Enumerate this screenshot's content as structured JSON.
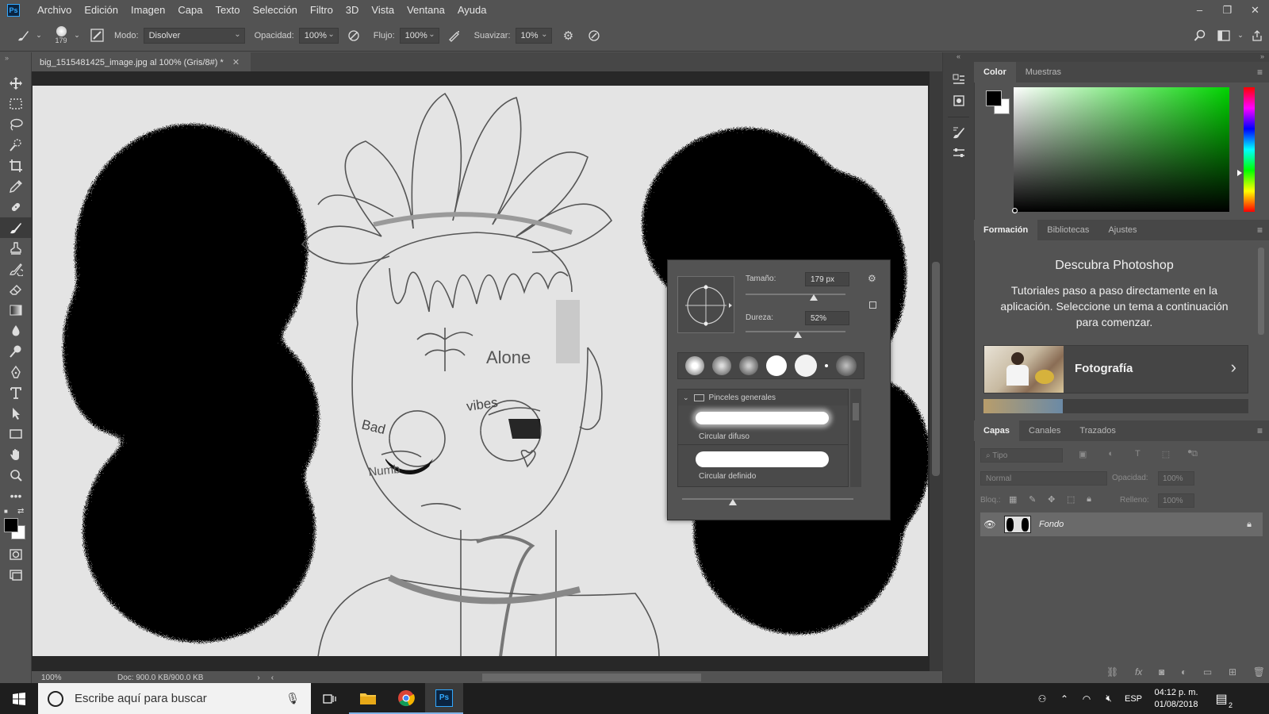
{
  "menubar": {
    "logo": "Ps",
    "items": [
      "Archivo",
      "Edición",
      "Imagen",
      "Capa",
      "Texto",
      "Selección",
      "Filtro",
      "3D",
      "Vista",
      "Ventana",
      "Ayuda"
    ],
    "window_controls": [
      "–",
      "❐",
      "✕"
    ]
  },
  "options": {
    "brush_size": "179",
    "mode_label": "Modo:",
    "mode_value": "Disolver",
    "opacity_label": "Opacidad:",
    "opacity_value": "100%",
    "flow_label": "Flujo:",
    "flow_value": "100%",
    "smoothing_label": "Suavizar:",
    "smoothing_value": "10%"
  },
  "document": {
    "tab_title": "big_1515481425_image.jpg al 100% (Gris/8#) *",
    "zoom": "100%",
    "doc_info": "Doc: 900.0 KB/900.0 KB"
  },
  "drawing": {
    "label_alone": "Alone",
    "label_bad": "Bad",
    "label_vibes": "vibes",
    "label_numb": "Numb"
  },
  "brush_popup": {
    "size_label": "Tamaño:",
    "size_value": "179 px",
    "hardness_label": "Dureza:",
    "hardness_value": "52%",
    "size_fraction": 0.68,
    "hardness_fraction": 0.52,
    "folder_name": "Pinceles generales",
    "brushes": [
      "Circular difuso",
      "Circular definido"
    ]
  },
  "color_panel": {
    "tabs": [
      "Color",
      "Muestras"
    ],
    "foreground": "#000000",
    "background": "#ffffff"
  },
  "learn_panel": {
    "tabs": [
      "Formación",
      "Bibliotecas",
      "Ajustes"
    ],
    "title": "Descubra Photoshop",
    "description": "Tutoriales paso a paso directamente en la aplicación. Seleccione un tema a continuación para comenzar.",
    "topic": "Fotografía"
  },
  "layers_panel": {
    "tabs": [
      "Capas",
      "Canales",
      "Trazados"
    ],
    "filter_placeholder": "Tipo",
    "blend_mode": "Normal",
    "opacity_label": "Opacidad:",
    "opacity_value": "100%",
    "lock_label": "Bloq.:",
    "fill_label": "Relleno:",
    "fill_value": "100%",
    "layers": [
      {
        "name": "Fondo"
      }
    ]
  },
  "taskbar": {
    "search_placeholder": "Escribe aquí para buscar",
    "language": "ESP",
    "time": "04:12 p. m.",
    "date": "01/08/2018",
    "notifications": "2"
  }
}
